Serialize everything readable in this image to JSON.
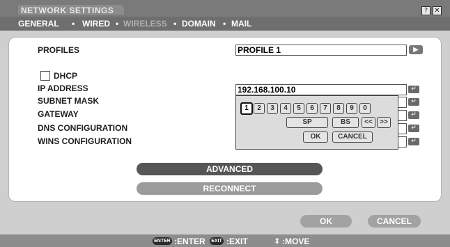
{
  "window": {
    "title": "NETWORK SETTINGS",
    "help_glyph": "?",
    "close_glyph": "✕"
  },
  "tabs": [
    {
      "label": "GENERAL",
      "state": "active"
    },
    {
      "label": "WIRED",
      "state": "normal"
    },
    {
      "label": "WIRELESS",
      "state": "disabled"
    },
    {
      "label": "DOMAIN",
      "state": "normal"
    },
    {
      "label": "MAIL",
      "state": "normal"
    }
  ],
  "tab_separator": "•",
  "form": {
    "profiles_label": "PROFILES",
    "profiles_value": "PROFILE 1",
    "dhcp_label": "DHCP",
    "dhcp_checked": false,
    "ip_label": "IP ADDRESS",
    "ip_value": "192.168.100.10",
    "subnet_label": "SUBNET MASK",
    "gateway_label": "GATEWAY",
    "dns_label": "DNS CONFIGURATION",
    "wins_label": "WINS CONFIGURATION",
    "arrow_glyph": "▶",
    "enter_glyph": "↵"
  },
  "keypad": {
    "digits": [
      "1",
      "2",
      "3",
      "4",
      "5",
      "6",
      "7",
      "8",
      "9",
      "0"
    ],
    "selected_digit": "1",
    "sp": "SP",
    "bs": "BS",
    "left": "<<",
    "right": ">>",
    "ok": "OK",
    "cancel": "CANCEL"
  },
  "buttons": {
    "advanced": "ADVANCED",
    "reconnect": "RECONNECT",
    "ok": "OK",
    "cancel": "CANCEL"
  },
  "footer": {
    "enter_key": "ENTER",
    "enter_text": ":ENTER",
    "exit_key": "EXIT",
    "exit_text": ":EXIT",
    "move_glyph": "⇕",
    "move_text": ":MOVE"
  },
  "colors": {
    "titlebar": "#7a7a7a",
    "tabbar": "#6e6e6e",
    "button_dark": "#555555",
    "button_light": "#9a9a9a"
  }
}
